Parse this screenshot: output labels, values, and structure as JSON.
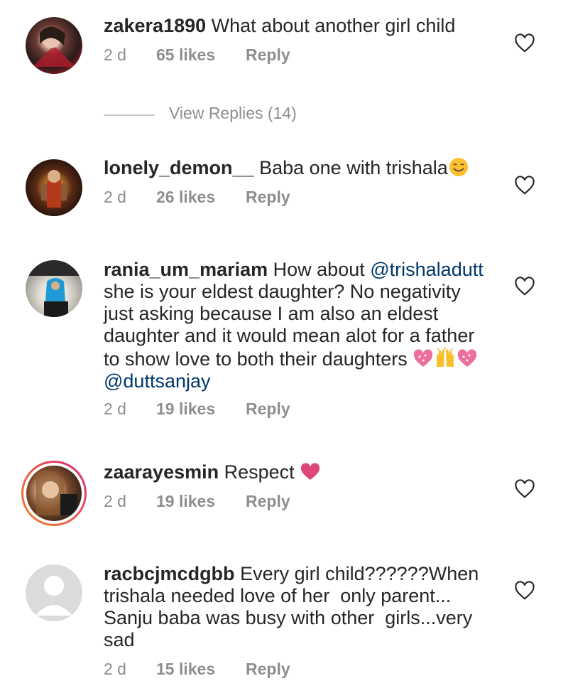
{
  "comments": [
    {
      "username": "zakera1890",
      "text": "What about another girl child",
      "time": "2 d",
      "likes": "65 likes",
      "reply": "Reply"
    },
    {
      "username": "lonely_demon__",
      "text": "Baba one with trishala",
      "emoji": "smiling-face-emoji",
      "time": "2 d",
      "likes": "26 likes",
      "reply": "Reply"
    },
    {
      "username": "rania_um_mariam",
      "text_line1": "How about",
      "mention1": "@trishaladutt",
      "text_line2": "she is your eldest daughter? No negativity",
      "text_line3": "just asking because I am also an eldest",
      "text_line4": "daughter and it would mean alot for a father",
      "text_line5": "to show love to both their daughters",
      "emojis": [
        "sparkling-heart-emoji",
        "raised-hands-emoji",
        "sparkling-heart-emoji"
      ],
      "mention2": "@duttsanjay",
      "time": "2 d",
      "likes": "19 likes",
      "reply": "Reply"
    },
    {
      "username": "zaarayesmin",
      "text": "Respect",
      "emoji": "heart-emoji",
      "time": "2 d",
      "likes": "19 likes",
      "reply": "Reply"
    },
    {
      "username": "racbcjmcdgbb",
      "text_line1": "Every girl child??????When",
      "text_line2": "trishala needed love of her  only parent...",
      "text_line3": "Sanju baba was busy with other  girls...very",
      "text_line4": "sad",
      "time": "2 d",
      "likes": "15 likes",
      "reply": "Reply"
    }
  ],
  "view_replies": "View Replies (14)",
  "colors": {
    "text": "#262626",
    "meta": "#8e8e8e",
    "mention": "#00376b",
    "heart_emoji": "#e0457b",
    "story_ring_start": "#f58529",
    "story_ring_end": "#dd2a7b"
  }
}
